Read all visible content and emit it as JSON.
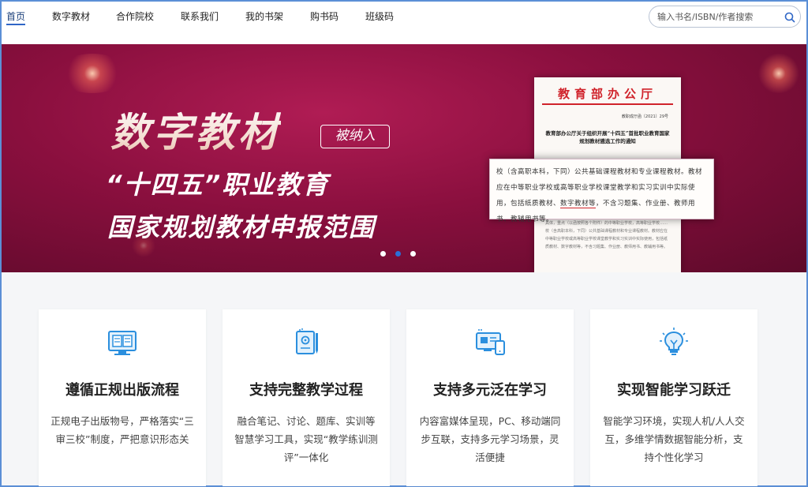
{
  "nav": {
    "items": [
      {
        "label": "首页",
        "active": true
      },
      {
        "label": "数字教材"
      },
      {
        "label": "合作院校"
      },
      {
        "label": "联系我们"
      },
      {
        "label": "我的书架"
      },
      {
        "label": "购书码"
      },
      {
        "label": "班级码"
      }
    ],
    "search": {
      "placeholder": "输入书名/ISBN/作者搜索",
      "icon": "search-icon"
    }
  },
  "banner": {
    "title": "数字教材",
    "tag": "被纳入",
    "line2": "“十四五”职业教育",
    "line3": "国家规划教材申报范围",
    "slides_current": 2,
    "slides_total": 3,
    "doc": {
      "head": "教育部办公厅",
      "number": "教职成厅函〔2021〕29号",
      "subject": "教育部办公厅关于组织开展“十四五”首批职业教育国家规划教材遴选工作的通知",
      "excerpt_a": "校（含高职本科，下同）公共基础课程教材和专业课程教材。教材应在中等职业学校或高等职业学校课堂教学和实习实训中实际使用，包括纸质教材、",
      "excerpt_hl": "数字教材等",
      "excerpt_b": "，不含习题集、作业册、教师用书、教辅用书等。",
      "back_lines": "具体，重点（以函按照各个附件）的中等职业学校，高等职业学校……校（含高职本科，下同）公共基础课程教材和专业课程教材。教材应在中等职业学校或高等职业学校课堂教学和实习实训中实际使用，包括纸质教材、数字教材等，不含习题集、作业册、教师用书、教辅用书等。"
    }
  },
  "features": [
    {
      "icon": "book-screen-icon",
      "title": "遵循正规出版流程",
      "desc": "正规电子出版物号，严格落实“三审三校”制度，严把意识形态关"
    },
    {
      "icon": "notebook-pen-icon",
      "title": "支持完整教学过程",
      "desc": "融合笔记、讨论、题库、实训等智慧学习工具，实现“教学练训测评”一体化"
    },
    {
      "icon": "multi-device-icon",
      "title": "支持多元泛在学习",
      "desc": "内容富媒体呈现，PC、移动端同步互联，支持多元学习场景，灵活便捷"
    },
    {
      "icon": "lightbulb-icon",
      "title": "实现智能学习跃迁",
      "desc": "智能学习环境，实现人机/人人交互，多维学情数据智能分析，支持个性化学习"
    }
  ],
  "colors": {
    "accent": "#2f66c6",
    "banner": "#9b1547",
    "icon": "#2b8fde"
  }
}
